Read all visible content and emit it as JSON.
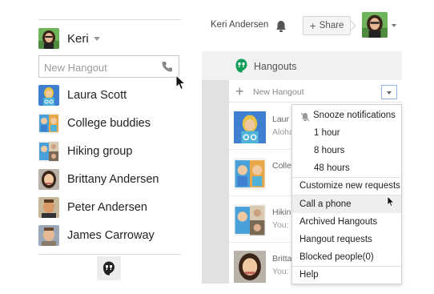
{
  "left_panel": {
    "user": {
      "name": "Keri"
    },
    "new_hangout_placeholder": "New Hangout",
    "contacts": [
      {
        "name": "Laura Scott"
      },
      {
        "name": "College buddies"
      },
      {
        "name": "Hiking group"
      },
      {
        "name": "Brittany Andersen"
      },
      {
        "name": "Peter Andersen"
      },
      {
        "name": "James Carroway"
      }
    ],
    "bottom_icon": "hangouts-logo-icon"
  },
  "topbar": {
    "user_name": "Keri Andersen",
    "share_label": "Share",
    "icons": [
      "bell-icon",
      "plus-icon",
      "avatar"
    ]
  },
  "hangouts_panel": {
    "title": "Hangouts",
    "new_hangout_label": "New Hangout",
    "conversations": [
      {
        "name": "Laur",
        "preview": "Aloha"
      },
      {
        "name": "Colle",
        "preview": ""
      },
      {
        "name": "Hikin",
        "preview": "You:"
      },
      {
        "name": "Britta",
        "preview": "You:"
      }
    ]
  },
  "menu": {
    "items": [
      {
        "label": "Snooze notifications"
      },
      {
        "label": "1 hour"
      },
      {
        "label": "8 hours"
      },
      {
        "label": "48 hours"
      },
      {
        "label": "Customize new requests"
      },
      {
        "label": "Call a phone"
      },
      {
        "label": "Archived Hangouts"
      },
      {
        "label": "Hangout requests"
      },
      {
        "label": "Blocked people(0)"
      },
      {
        "label": "Help"
      }
    ],
    "hovered": "Call a phone"
  },
  "colors": {
    "hangouts_green": "#0f9d58",
    "dropdown_border": "#8fb0e8",
    "menu_hover": "#eeeeee"
  }
}
